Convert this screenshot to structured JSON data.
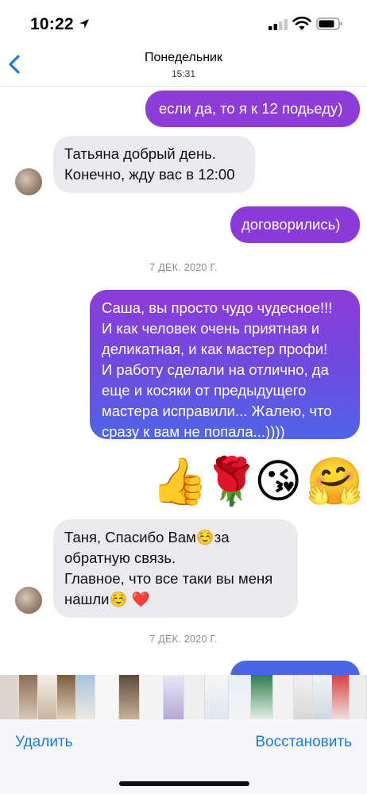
{
  "status_bar": {
    "time": "10:22"
  },
  "header": {
    "title": "Понедельник",
    "subtitle": "15:31"
  },
  "messages": {
    "m1": "если да, то я к 12 подьеду)",
    "m2_line1": "Татьяна добрый день.",
    "m2_line2": "Конечно, жду вас в 12:00",
    "m3": "договорились)",
    "date1": "7 ДЕК. 2020 Г.",
    "m4_lines": [
      "Саша, вы просто чудо чудесное!!!",
      "И как человек очень приятная и",
      "деликатная, и как мастер профи!",
      "И работу сделали на отлично, да",
      "еще и косяки от предыдущего",
      "мастера исправили... Жалею, что",
      "сразу к вам не попала...))))"
    ],
    "emojis": [
      "👍",
      "🌹",
      "😘",
      "🤗"
    ],
    "m5_line1": "Таня, Спасибо Вам☺️за",
    "m5_line2": "обратную связь.",
    "m5_line3": "Главное, что все таки вы меня",
    "m5_line4": "нашли☺️ ❤️",
    "date2": "7 ДЕК. 2020 Г."
  },
  "toolbar": {
    "delete_label": "Удалить",
    "restore_label": "Восстановить"
  },
  "colors": {
    "accent": "#1a7ce0",
    "bubble_purple": "#8a3fd9",
    "bubble_blue": "#4a66e6",
    "incoming": "#ebebef"
  }
}
